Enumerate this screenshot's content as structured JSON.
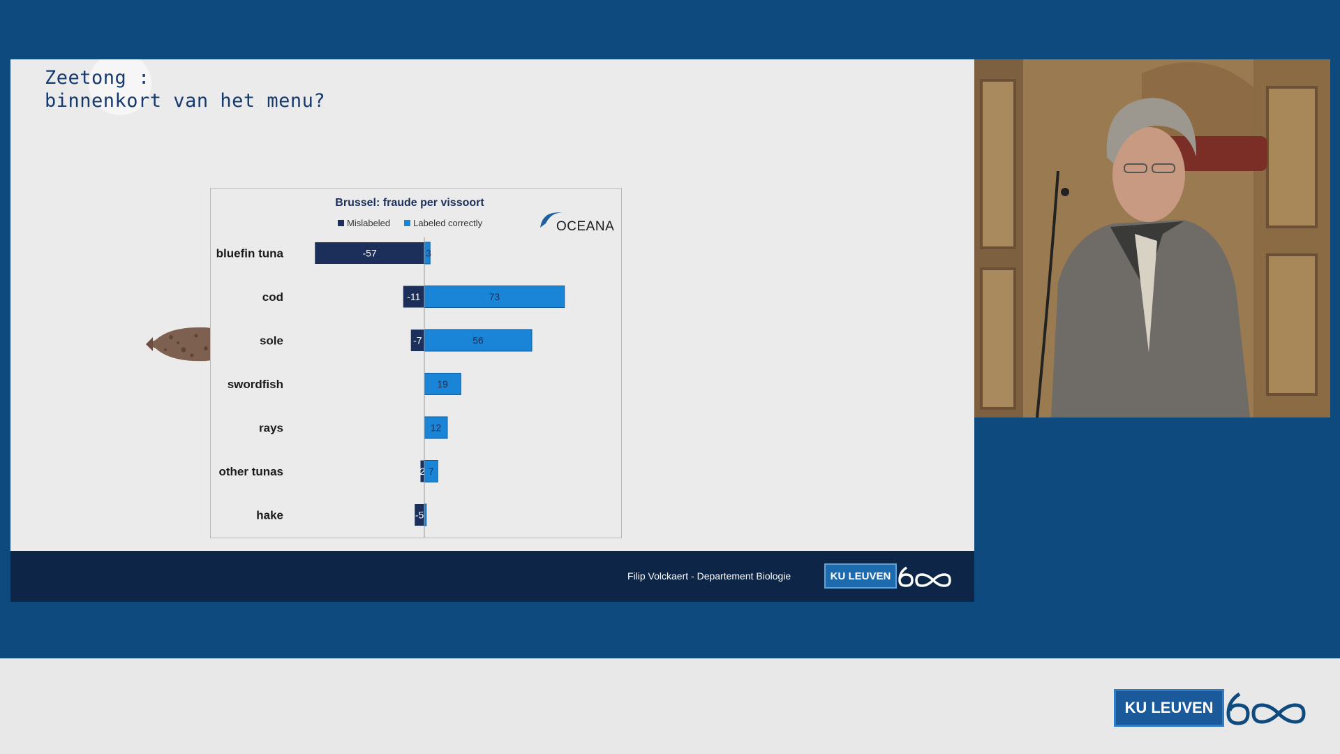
{
  "slide": {
    "title_line1": "Zeetong :",
    "title_line2": "binnenkort van het menu?"
  },
  "chart": {
    "title": "Brussel: fraude per vissoort",
    "legend_mislabeled": "Mislabeled",
    "legend_correct": "Labeled correctly",
    "source_logo": "OCEANA"
  },
  "chart_data": {
    "type": "bar",
    "orientation": "horizontal-diverging",
    "title": "Brussel: fraude per vissoort",
    "categories": [
      "bluefin tuna",
      "cod",
      "sole",
      "swordfish",
      "rays",
      "other tunas",
      "hake"
    ],
    "series": [
      {
        "name": "Mislabeled",
        "values": [
          -57,
          -11,
          -7,
          0,
          0,
          -2,
          -5
        ],
        "labels": [
          "-57",
          "-11",
          "-7",
          "",
          "",
          "2",
          "-5"
        ],
        "color": "#1b2f5a"
      },
      {
        "name": "Labeled correctly",
        "values": [
          3,
          73,
          56,
          19,
          12,
          7,
          1
        ],
        "labels": [
          "3",
          "73",
          "56",
          "19",
          "12",
          "7",
          ""
        ],
        "color": "#1a85d6"
      }
    ],
    "xlim": [
      -57,
      73
    ],
    "legend": "top"
  },
  "footer": {
    "credit": "Filip Volckaert - Departement Biologie",
    "logo_text": "KU LEUVEN",
    "logo_number": "600"
  },
  "bottom_logo": {
    "logo_text": "KU LEUVEN",
    "logo_number": "600"
  },
  "colors": {
    "background_blue": "#0f4a7f",
    "footer_navy": "#0d2547",
    "bar_dark": "#1b2f5a",
    "bar_light": "#1a85d6"
  }
}
